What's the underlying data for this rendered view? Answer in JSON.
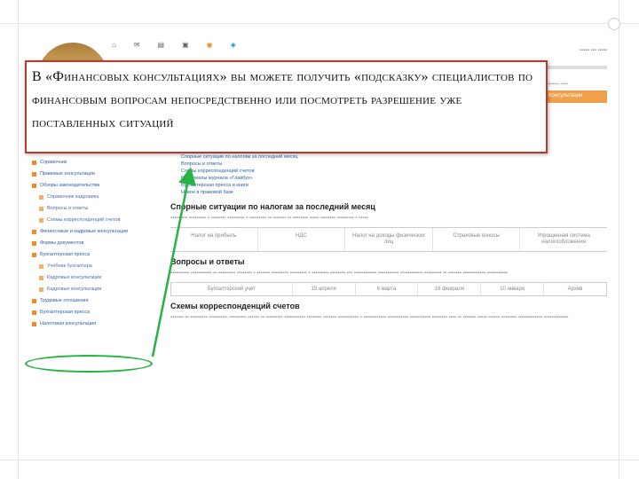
{
  "callout": {
    "text": "В «Финансовых консультациях» вы можете получить «подсказку» специалистов по финансовым вопросам непосредственно или посмотреть разрешение уже поставленных ситуаций"
  },
  "site": {
    "sidebar_items": [
      {
        "label": "Справочник"
      },
      {
        "label": "Правовые консультации"
      },
      {
        "label": "Обзоры законодательства"
      },
      {
        "label": "Справочник кадровика"
      },
      {
        "label": "Вопросы и ответы"
      },
      {
        "label": "Схемы корреспонденций счетов"
      },
      {
        "label": "Финансовые и кадровые консультации"
      },
      {
        "label": "Формы документов"
      },
      {
        "label": "Бухгалтерская пресса"
      },
      {
        "label": "Учебник бухгалтера"
      },
      {
        "label": "Кадровые консультации"
      },
      {
        "label": "Кадровые консультации"
      },
      {
        "label": "Трудовые отношения"
      },
      {
        "label": "Бухгалтерская пресса"
      },
      {
        "label": "Налоговая консультация"
      }
    ],
    "menu_items": [
      {
        "label": "Спорные ситуации по налогам за последний месяц"
      },
      {
        "label": "Вопросы и ответы"
      },
      {
        "label": "Схемы корреспонденций счетов"
      },
      {
        "label": "Материалы журнала «Главбух»"
      },
      {
        "label": "Бухгалтерская пресса и книги"
      },
      {
        "label": "Новое в правовой базе"
      }
    ],
    "section_disputes_heading": "Спорные ситуации по налогам за последний месяц",
    "section_qa_heading": "Вопросы и ответы",
    "section_schemes_heading": "Схемы корреспонденций счетов",
    "table_cols": [
      {
        "label": "Налог на прибыль"
      },
      {
        "label": "НДС"
      },
      {
        "label": "Налог на доходы физических лиц"
      },
      {
        "label": "Страховые взносы"
      },
      {
        "label": "Упрощенная система налогообложения"
      }
    ],
    "qa_row": [
      {
        "label": "Бухгалтерский учет"
      },
      {
        "label": "15 апреля"
      },
      {
        "label": "6 марта"
      },
      {
        "label": "16 февраля"
      },
      {
        "label": "10 января"
      },
      {
        "label": "Архив"
      }
    ],
    "right_btn": "Консультации"
  }
}
